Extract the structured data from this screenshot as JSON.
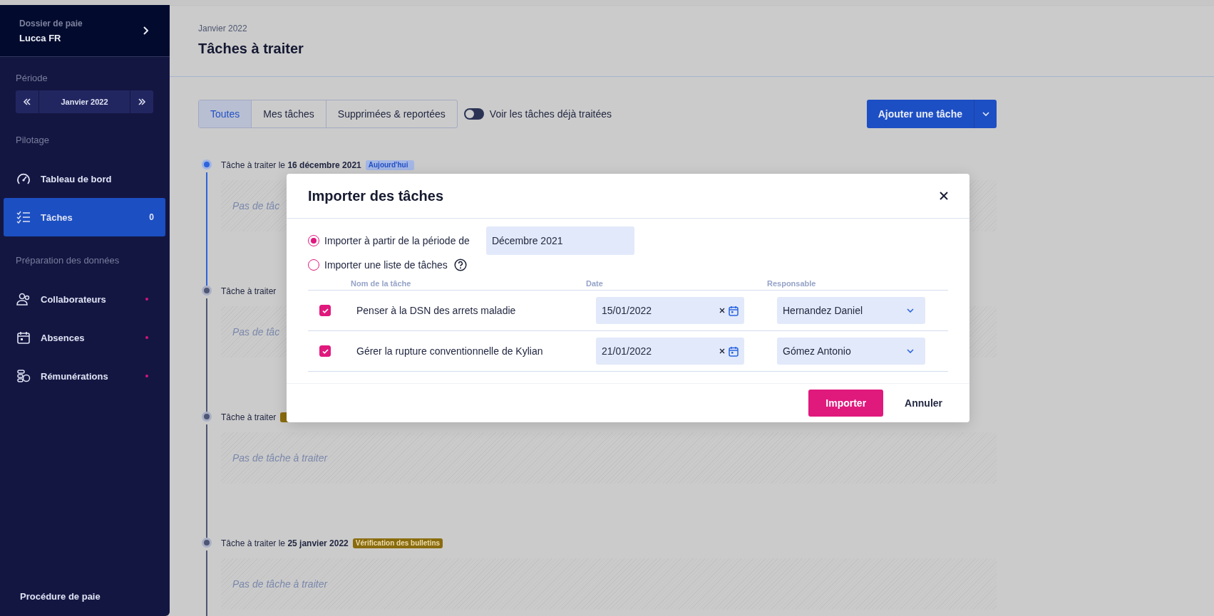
{
  "sidebar": {
    "folder_label": "Dossier de paie",
    "folder_name": "Lucca FR",
    "period_label": "Période",
    "period": "Janvier 2022",
    "sections": [
      {
        "title": "Pilotage",
        "items": [
          {
            "label": "Tableau de bord",
            "kind": "gauge",
            "selected": false,
            "alert": false
          },
          {
            "label": "Tâches",
            "kind": "checklist",
            "count": "0",
            "selected": true,
            "alert": false
          }
        ]
      },
      {
        "title": "Préparation des données",
        "items": [
          {
            "label": "Collaborateurs",
            "kind": "people",
            "selected": false,
            "alert": true
          },
          {
            "label": "Absences",
            "kind": "calendar",
            "selected": false,
            "alert": true
          },
          {
            "label": "Rémunérations",
            "kind": "coins",
            "selected": false,
            "alert": true
          }
        ]
      }
    ],
    "footer": "Procédure de paie"
  },
  "header": {
    "period": "Janvier 2022",
    "title": "Tâches à traiter"
  },
  "filters": [
    {
      "label": "Toutes",
      "selected": true
    },
    {
      "label": "Mes tâches",
      "selected": false
    },
    {
      "label": "Supprimées & reportées",
      "selected": false
    }
  ],
  "toggle": {
    "label": "Voir les tâches déjà traitées",
    "on": false
  },
  "add_button": "Ajouter une tâche",
  "timeline": [
    {
      "label": "Tâche à traiter le **16 décembre 2021**",
      "current": true,
      "badge": {
        "kind": "today",
        "label": "Aujourd'hui"
      },
      "empty_text": "Pas de tâc"
    },
    {
      "label": "Tâche à traiter",
      "current": false,
      "empty_text": "Pas de tâc"
    },
    {
      "label": "Tâche à traiter",
      "current": false,
      "badge": {
        "kind": "step"
      },
      "empty_text": "Pas de tâche à traiter"
    },
    {
      "label": "Tâche à traiter le **25 janvier 2022**",
      "current": false,
      "badge": {
        "kind": "step",
        "label": "Vérification des bulletins"
      },
      "empty_text": "Pas de tâche à traiter"
    }
  ],
  "modal": {
    "title": "Importer des tâches",
    "options": [
      {
        "label": "Importer à partir de la période de",
        "selected": true,
        "field": "Décembre 2021"
      },
      {
        "label": "Importer une liste de tâches",
        "selected": false,
        "help": true
      }
    ],
    "columns": [
      "Nom de la tâche",
      "Date",
      "Responsable"
    ],
    "rows": [
      {
        "checked": true,
        "name": "Penser à la DSN des arrets maladie",
        "date": "15/01/2022",
        "assignee": "Hernandez Daniel"
      },
      {
        "checked": true,
        "name": "Gérer la rupture conventionnelle de Kylian",
        "date": "21/01/2022",
        "assignee": "Gómez Antonio"
      }
    ],
    "buttons": [
      {
        "label": "Importer",
        "kind": "primary"
      },
      {
        "label": "Annuler",
        "kind": "secondary"
      }
    ]
  }
}
